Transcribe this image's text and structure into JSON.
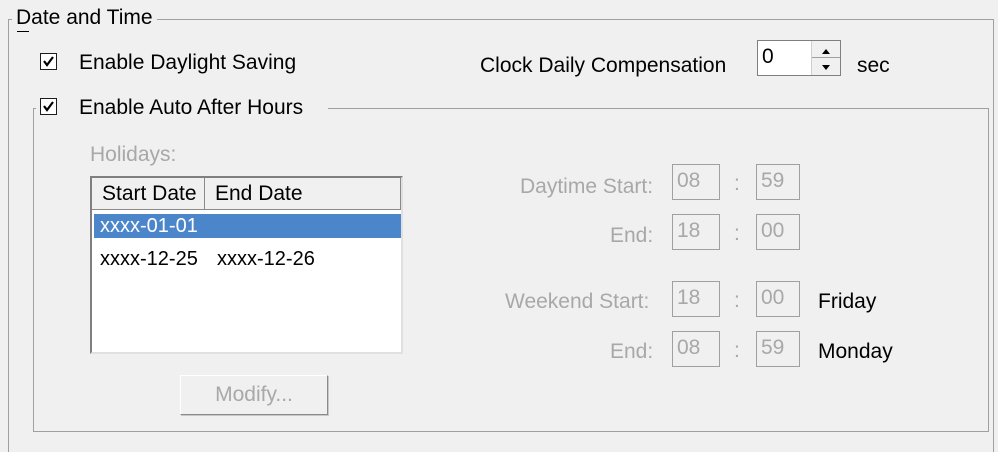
{
  "group_datetime": {
    "title": "Date and Time"
  },
  "daylight": {
    "label": "Enable Daylight Saving",
    "checked": true
  },
  "compensation": {
    "label": "Clock Daily Compensation",
    "value": "0",
    "unit": "sec"
  },
  "after_hours": {
    "label": "Enable Auto After Hours",
    "checked": true
  },
  "holidays": {
    "label": "Holidays:",
    "columns": [
      "Start Date",
      "End Date"
    ],
    "rows": [
      {
        "start": "xxxx-01-01",
        "end": ""
      },
      {
        "start": "xxxx-12-25",
        "end": "xxxx-12-26"
      }
    ],
    "modify_label": "Modify..."
  },
  "daytime": {
    "start_label": "Daytime Start:",
    "start_h": "08",
    "start_m": "59",
    "end_label": "End:",
    "end_h": "18",
    "end_m": "00"
  },
  "weekend": {
    "start_label": "Weekend Start:",
    "start_h": "18",
    "start_m": "00",
    "start_day": "Friday",
    "end_label": "End:",
    "end_h": "08",
    "end_m": "59",
    "end_day": "Monday"
  },
  "time_separator": ":",
  "colors": {
    "selection": "#4a86c9",
    "disabled_text": "#a8a8a8"
  }
}
